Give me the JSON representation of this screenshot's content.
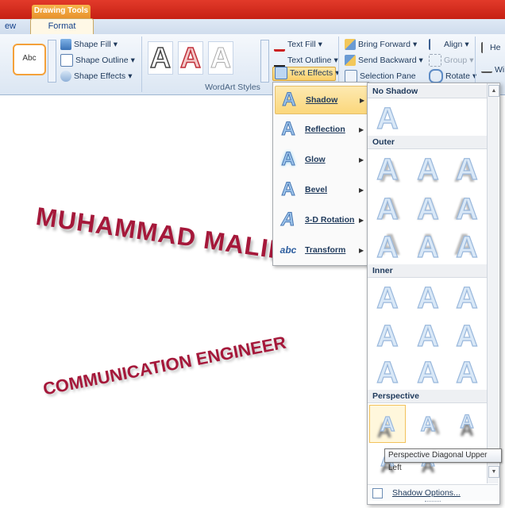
{
  "contextual_tab": "Drawing Tools",
  "tabs": {
    "previous": "ew",
    "active": "Format"
  },
  "shape_styles": {
    "preview": "Abc",
    "fill": "Shape Fill",
    "outline": "Shape Outline",
    "effects": "Shape Effects"
  },
  "wordart": {
    "group_label": "WordArt Styles",
    "samples": [
      "A",
      "A",
      "A"
    ],
    "text_fill": "Text Fill",
    "text_outline": "Text Outline",
    "text_effects": "Text Effects"
  },
  "arrange": {
    "bring_forward": "Bring Forward",
    "send_backward": "Send Backward",
    "selection_pane": "Selection Pane",
    "align": "Align",
    "group": "Group",
    "rotate": "Rotate",
    "height": "He",
    "width": "Wi"
  },
  "document": {
    "name": "MUHAMMAD MALIK",
    "title": "COMMUNICATION ENGINEER"
  },
  "menu": {
    "items": [
      {
        "label": "Shadow",
        "icon": "A"
      },
      {
        "label": "Reflection",
        "icon": "A"
      },
      {
        "label": "Glow",
        "icon": "A"
      },
      {
        "label": "Bevel",
        "icon": "A"
      },
      {
        "label": "3-D Rotation",
        "icon": "A"
      },
      {
        "label": "Transform",
        "icon": "abc"
      }
    ]
  },
  "gallery": {
    "sections": [
      "No Shadow",
      "Outer",
      "Inner",
      "Perspective"
    ],
    "glyph": "A",
    "tooltip": "Perspective Diagonal Upper Left",
    "options": "Shadow Options..."
  },
  "colors": {
    "accent_red": "#c62013",
    "highlight": "#fbd77b",
    "wordart_text": "#a5183a"
  }
}
